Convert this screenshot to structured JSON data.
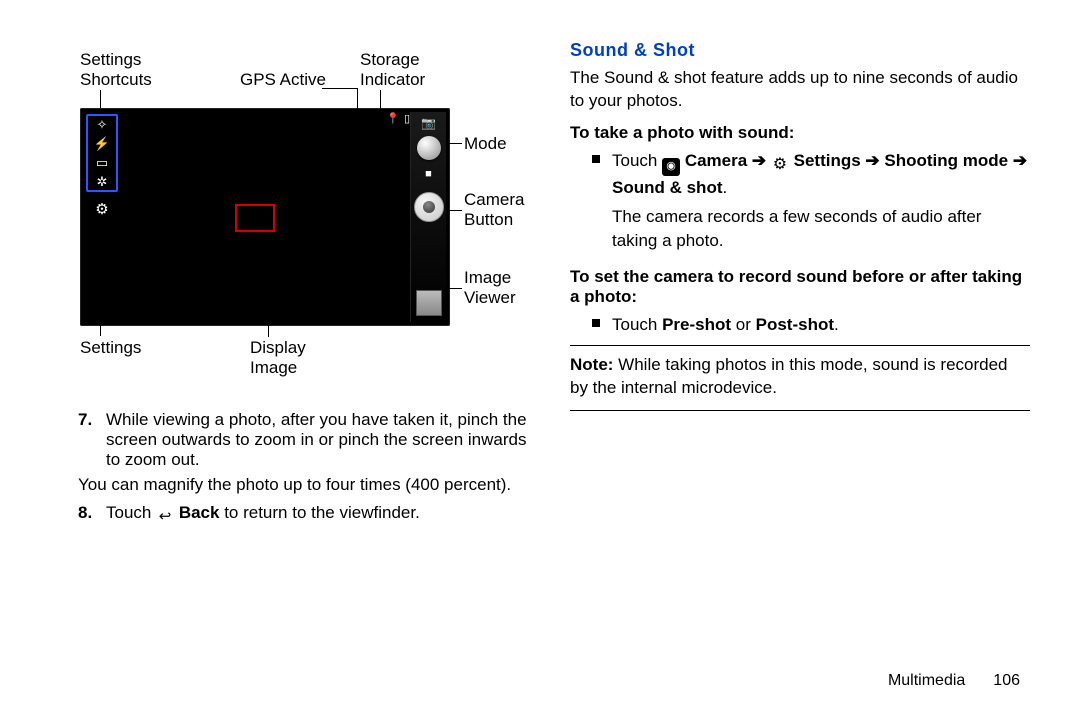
{
  "diagram": {
    "callouts": {
      "settings_shortcuts": "Settings\nShortcuts",
      "gps_active": "GPS Active",
      "storage_indicator": "Storage\nIndicator",
      "mode": "Mode",
      "camera_button": "Camera\nButton",
      "image_viewer": "Image\nViewer",
      "settings": "Settings",
      "display_image": "Display\nImage"
    }
  },
  "left": {
    "item7_num": "7.",
    "item7_text": "While viewing a photo, after you have taken it, pinch the screen outwards to zoom in or pinch the screen inwards to zoom out.",
    "item7_sub": "You can magnify the photo up to four times (400 percent).",
    "item8_num": "8.",
    "item8_pre": "Touch ",
    "item8_bold": " Back",
    "item8_post": " to return to the viewfinder."
  },
  "right": {
    "title": "Sound & Shot",
    "intro": "The Sound & shot feature adds up to nine seconds of audio to your photos.",
    "take_h": "To take a photo with sound:",
    "b1_pre": "Touch ",
    "b1_cam": " Camera ",
    "b1_arr1": "➔",
    "b1_set": " Settings ",
    "b1_arr2": "➔",
    "b1_shoot": " Shooting mode ",
    "b1_arr3": "➔",
    "b1_ss": " Sound & shot",
    "b1_dot": ".",
    "b1_after": "The camera records a few seconds of audio after taking a photo.",
    "set_h": "To set the camera to record sound before or after taking a photo:",
    "b2_pre": "Touch ",
    "b2_b1": "Pre-shot",
    "b2_mid": " or ",
    "b2_b2": "Post-shot",
    "b2_dot": ".",
    "note_label": "Note:",
    "note_text": " While taking photos in this mode, sound is recorded by the internal microdevice."
  },
  "footer": {
    "section": "Multimedia",
    "page": "106"
  }
}
